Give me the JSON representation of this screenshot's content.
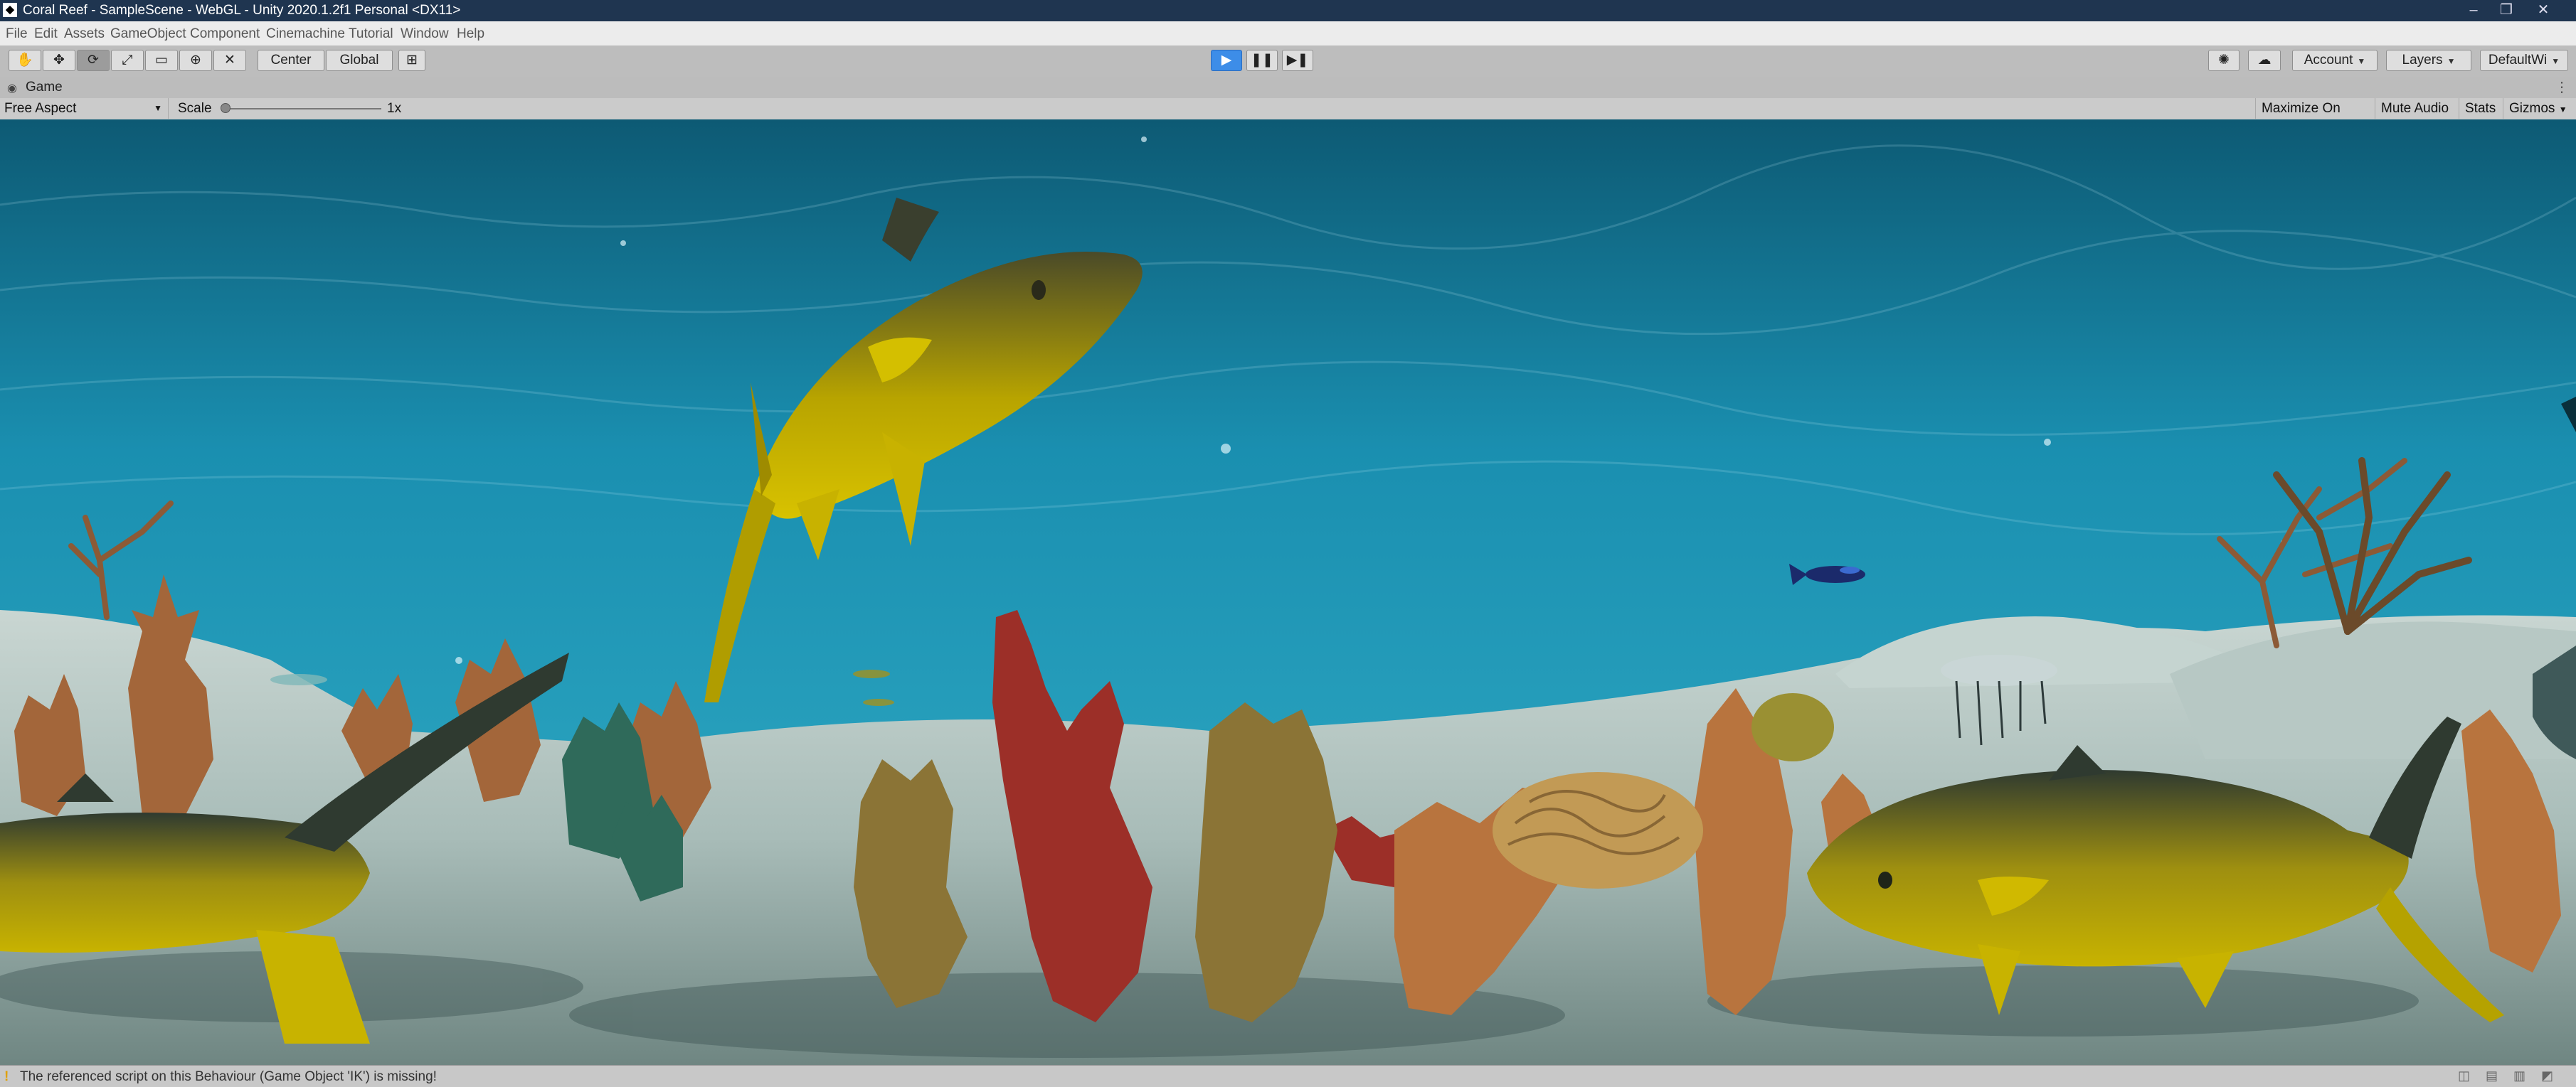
{
  "window": {
    "title": "Coral Reef - SampleScene - WebGL - Unity 2020.1.2f1 Personal <DX11>",
    "app_icon": "unity-logo-icon",
    "controls": [
      "minimize-icon",
      "restore-icon",
      "close-icon"
    ]
  },
  "menu": [
    "File",
    "Edit",
    "Assets",
    "GameObject",
    "Component",
    "Cinemachine",
    "Tutorial",
    "Window",
    "Help"
  ],
  "toolbar": {
    "tools": [
      "hand-tool-icon",
      "move-tool-icon",
      "rotate-tool-icon",
      "scale-tool-icon",
      "rect-tool-icon",
      "transform-tool-icon",
      "custom-tool-icon"
    ],
    "active_tool": "rotate-tool-icon",
    "pivot_mode": "Center",
    "pivot_rotation": "Global",
    "play_controls": [
      "play-icon",
      "pause-icon",
      "step-icon"
    ],
    "playing": true,
    "account_label": "Account",
    "layers_label": "Layers",
    "layout_label": "DefaultWi"
  },
  "game_tab": {
    "label": "Game"
  },
  "game_bar": {
    "aspect": "Free Aspect",
    "scale_label": "Scale",
    "scale_value": "1x",
    "maximize_on_play": "Maximize On Play",
    "mute_audio": "Mute Audio",
    "stats": "Stats",
    "gizmos": "Gizmos"
  },
  "status": {
    "message": "The referenced script on this Behaviour (Game Object 'IK') is missing!",
    "icon": "warning-icon"
  },
  "colors": {
    "play_active": "#3d8de8",
    "water": "#1a8fb0",
    "sand": "#b8c9c4",
    "fish_yellow": "#c9b400"
  }
}
